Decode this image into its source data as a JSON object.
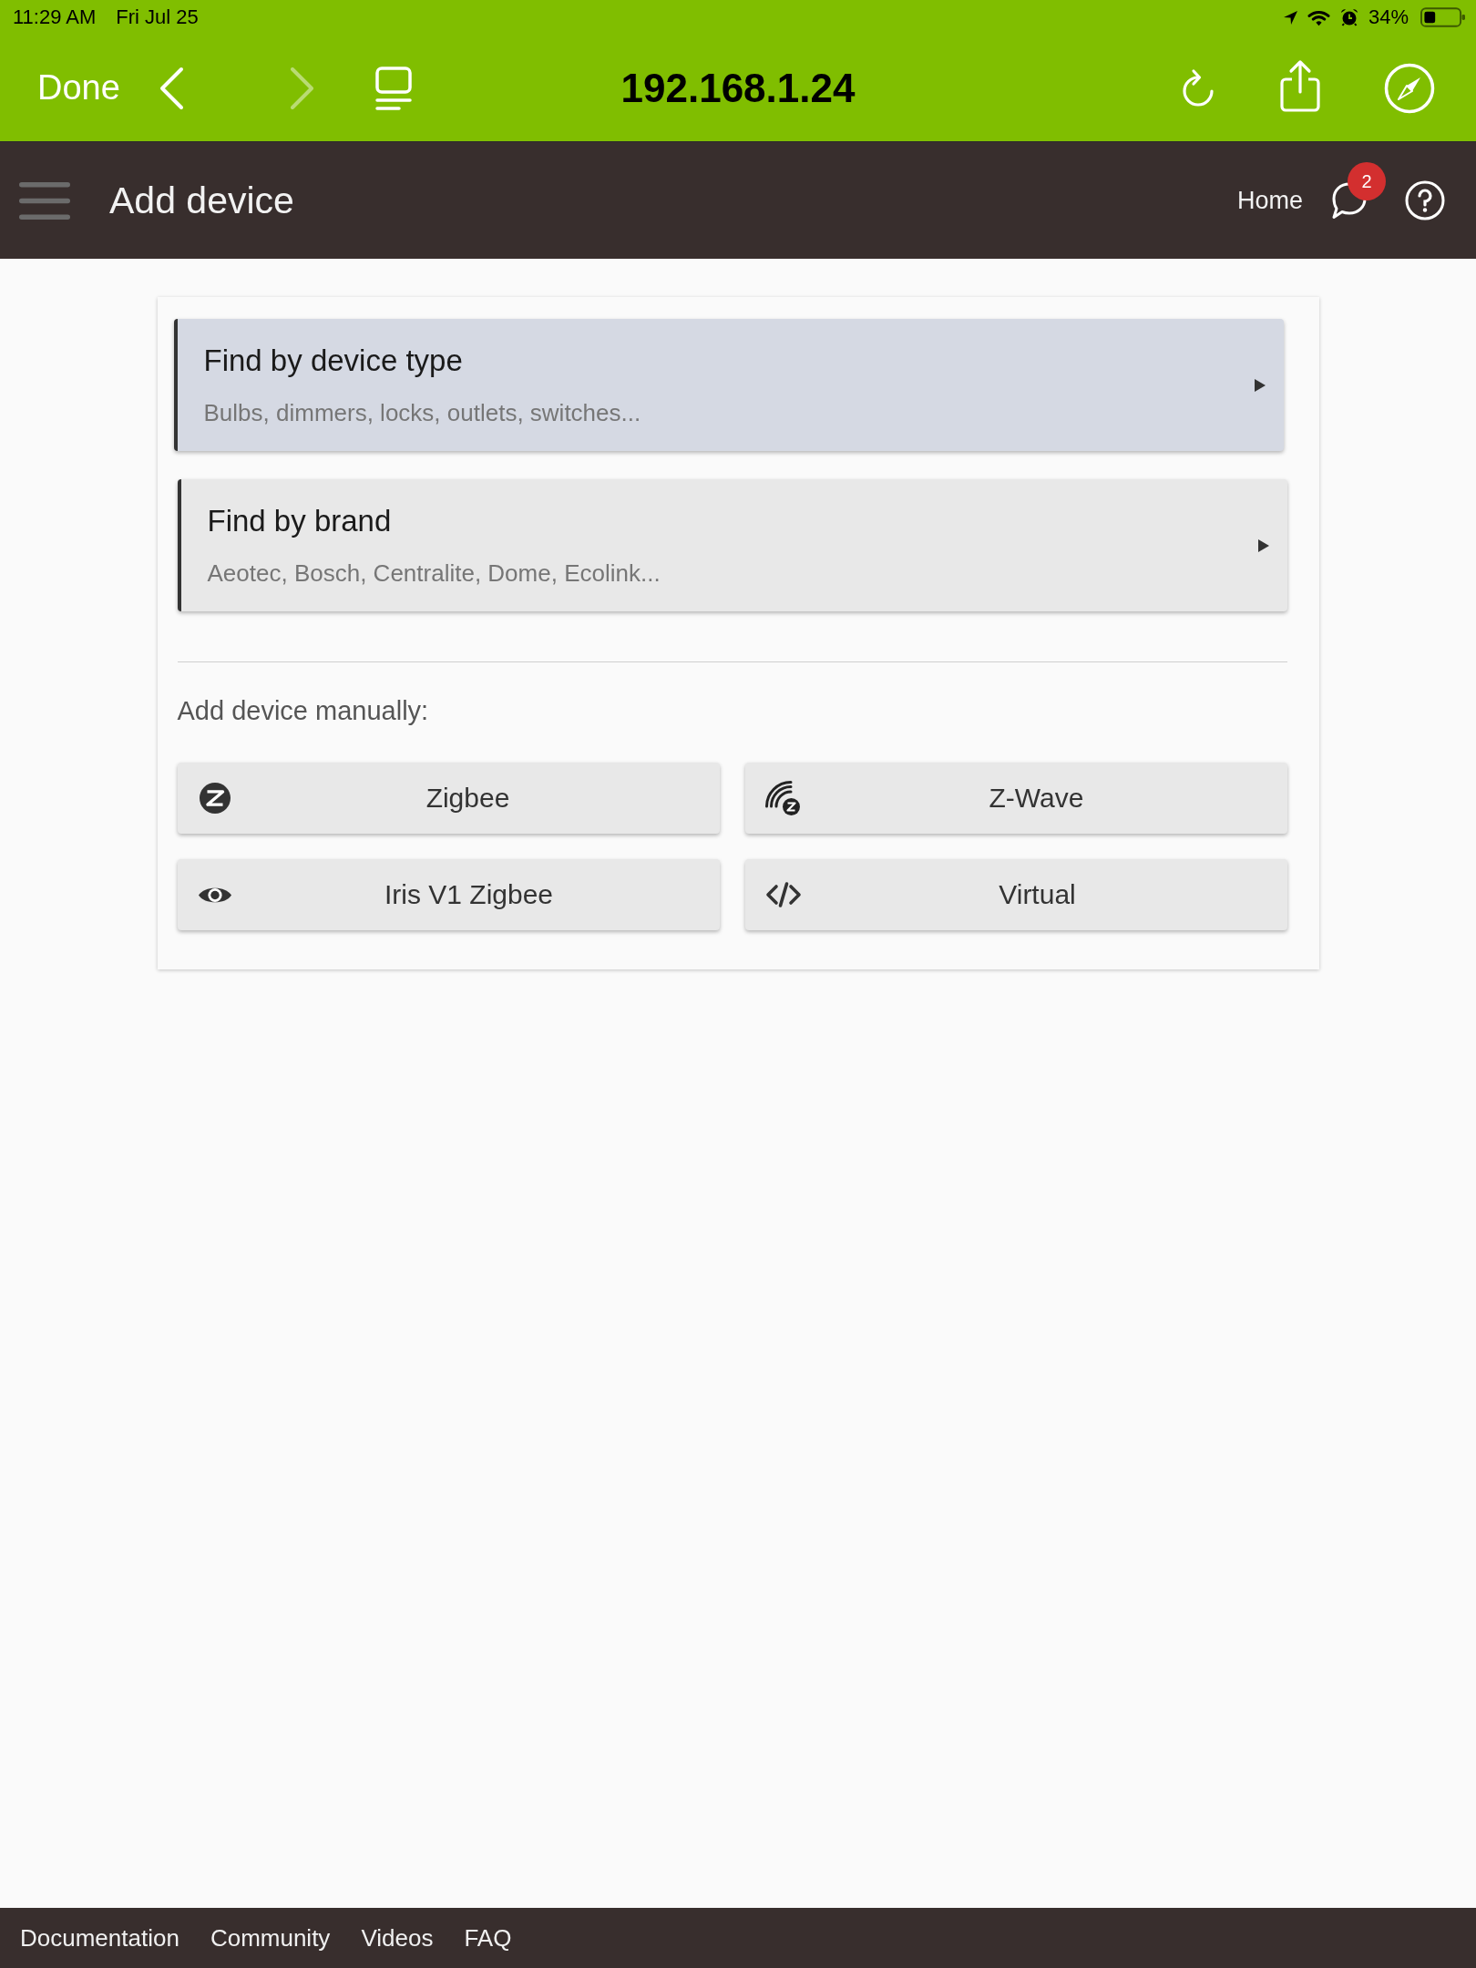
{
  "status_bar": {
    "time": "11:29 AM",
    "date": "Fri Jul 25",
    "battery": "34%"
  },
  "browser_bar": {
    "done": "Done",
    "nav": [
      {
        "kind": "back",
        "disabled": false
      },
      {
        "kind": "forward",
        "disabled": true
      }
    ],
    "url": "192.168.1.24"
  },
  "app_bar": {
    "title": "Add device",
    "home": "Home",
    "notification_count": "2"
  },
  "find_options": [
    {
      "title": "Find by device type",
      "subtitle": "Bulbs, dimmers, locks, outlets, switches...",
      "selected": true
    },
    {
      "title": "Find by brand",
      "subtitle": "Aeotec, Bosch, Centralite, Dome, Ecolink...",
      "selected": false
    }
  ],
  "manual": {
    "label": "Add device manually:",
    "buttons": [
      {
        "kind": "zigbee",
        "label": "Zigbee"
      },
      {
        "kind": "zwave",
        "label": "Z-Wave"
      },
      {
        "kind": "iris",
        "label": "Iris V1 Zigbee"
      },
      {
        "kind": "virtual",
        "label": "Virtual"
      }
    ]
  },
  "footer_links": [
    "Documentation",
    "Community",
    "Videos",
    "FAQ"
  ]
}
